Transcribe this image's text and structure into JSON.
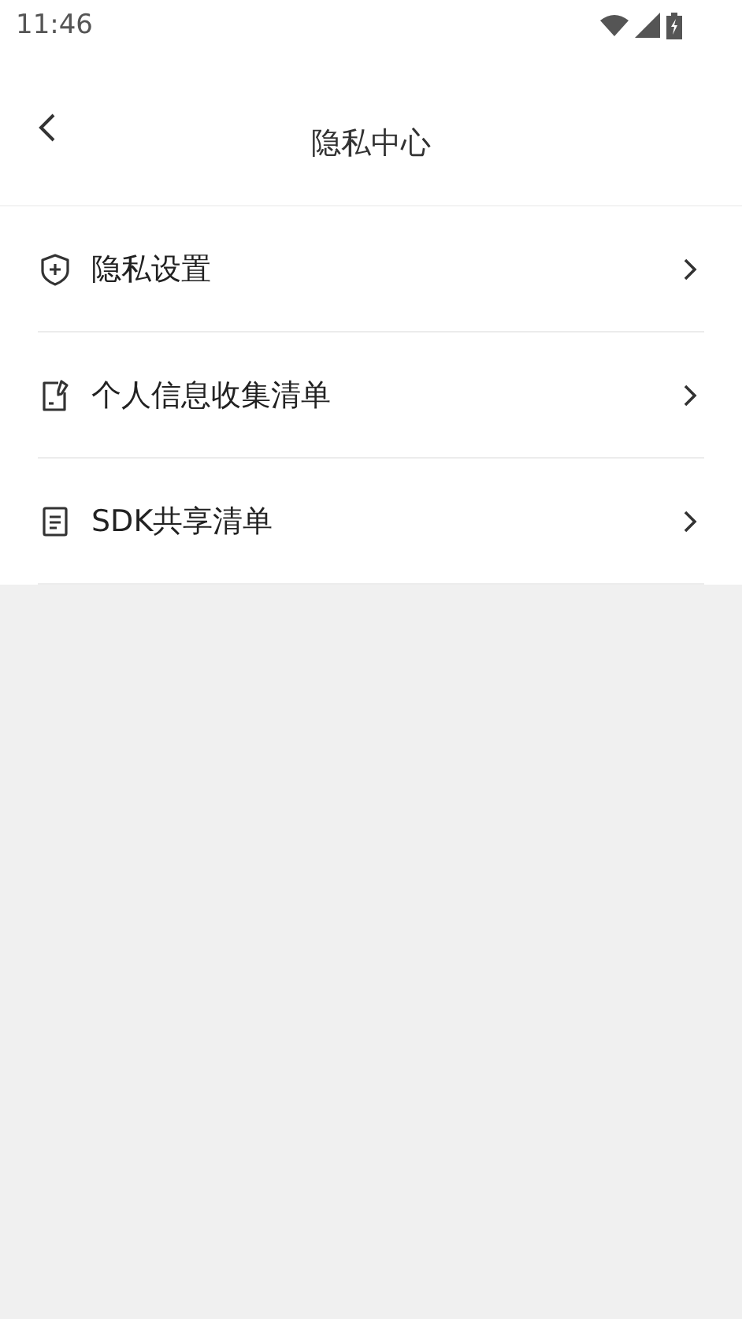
{
  "status_bar": {
    "time": "11:46"
  },
  "header": {
    "title": "隐私中心"
  },
  "items": [
    {
      "kind": "shield",
      "label": "隐私设置"
    },
    {
      "kind": "note",
      "label": "个人信息收集清单"
    },
    {
      "kind": "document",
      "label": "SDK共享清单"
    }
  ]
}
